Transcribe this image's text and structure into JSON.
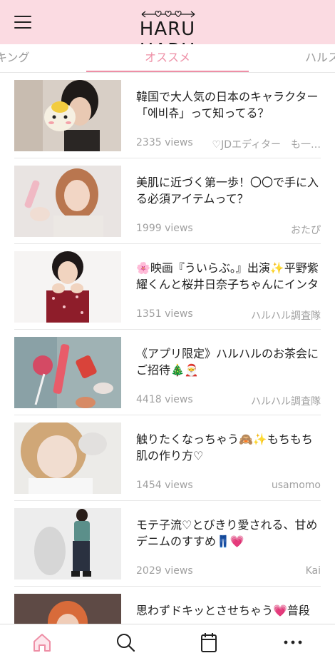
{
  "header": {
    "logo": "HARU HARU",
    "menu_icon": "hamburger-menu-icon"
  },
  "tabs": [
    {
      "label": "キング"
    },
    {
      "label": "オススメ",
      "active": true
    },
    {
      "label": "ハルス"
    }
  ],
  "colors": {
    "header_bg": "#fbdbe2",
    "accent": "#ee8fa6",
    "muted_text": "#a0a0a0"
  },
  "articles": [
    {
      "title": "韓国で大人気の日本のキャラクター「에비츄」って知ってる？",
      "views": "2335 views",
      "author": "♡JDエディター　も一…"
    },
    {
      "title": "美肌に近づく第一歩！〇〇で手に入る必須アイテムって？",
      "views": "1999 views",
      "author": "おたぴ"
    },
    {
      "title": "🌸映画『ういらぶ。』出演✨平野紫耀くんと桜井日奈子ちゃんにインタビュー💖",
      "views": "1351 views",
      "author": "ハルハル調査隊"
    },
    {
      "title": "《アプリ限定》ハルハルのお茶会にご招待🎄🎅",
      "views": "4418 views",
      "author": "ハルハル調査隊"
    },
    {
      "title": "触りたくなっちゃう🙈✨もちもち肌の作り方♡",
      "views": "1454 views",
      "author": "usamomo"
    },
    {
      "title": "モテ子流♡とびきり愛される、甘めデニムのすすめ👖💗",
      "views": "2029 views",
      "author": "Kai"
    },
    {
      "title": "思わずドキッとさせちゃう💗普段",
      "views": "",
      "author": ""
    }
  ],
  "bottom_nav": [
    {
      "icon": "home-icon"
    },
    {
      "icon": "search-icon"
    },
    {
      "icon": "calendar-icon"
    },
    {
      "icon": "more-icon"
    }
  ]
}
